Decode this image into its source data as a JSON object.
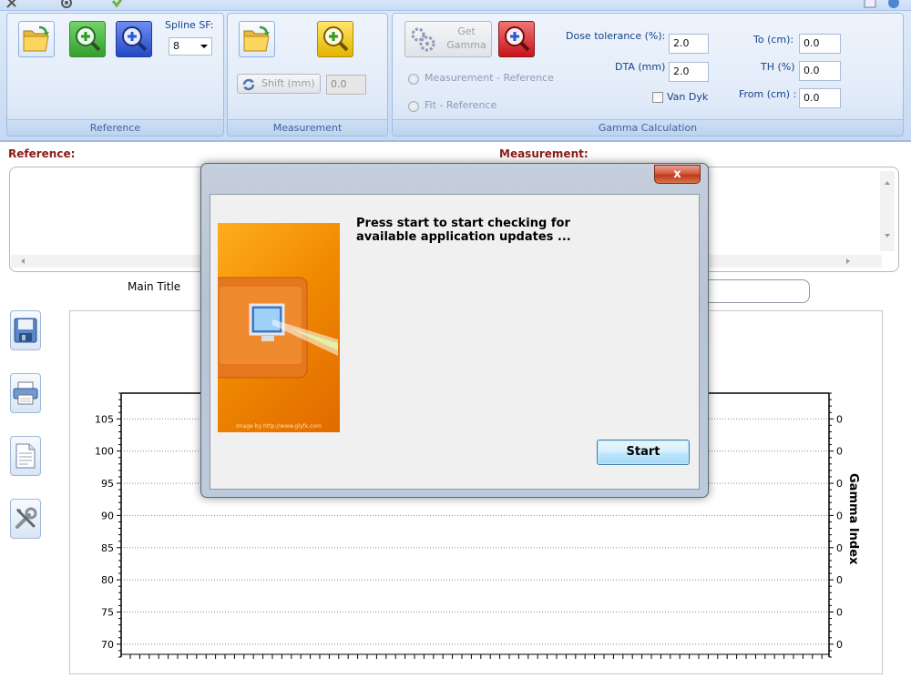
{
  "ribbon": {
    "reference": {
      "label": "Reference",
      "spline_label": "Spline SF:",
      "spline_value": "8"
    },
    "measurement": {
      "label": "Measurement",
      "shift_label": "Shift (mm)",
      "shift_value": "0.0"
    },
    "gamma": {
      "label": "Gamma Calculation",
      "get_gamma_line1": "Get",
      "get_gamma_line2": "Gamma",
      "radio_measurement_reference": "Measurement - Reference",
      "radio_fit_reference": "Fit - Reference",
      "dose_tolerance_label": "Dose tolerance (%):",
      "dose_tolerance_value": "2.0",
      "dta_label": "DTA (mm)",
      "dta_value": "2.0",
      "van_dyk_label": "Van Dyk",
      "to_label": "To (cm):",
      "to_value": "0.0",
      "th_label": "TH (%)",
      "th_value": "0.0",
      "from_label": "From (cm) :",
      "from_value": "0.0"
    }
  },
  "main": {
    "reference_title": "Reference:",
    "measurement_title": "Measurement:",
    "chart_main_title": "Main Title"
  },
  "chart_data": {
    "type": "line",
    "y_ticks": [
      105,
      100,
      95,
      90,
      85,
      80,
      75,
      70
    ],
    "ylim": [
      68,
      109
    ],
    "y2label": "Gamma Index",
    "y2_ticks": [
      "0",
      "0",
      "0",
      "0",
      "0",
      "0",
      "0",
      "0"
    ],
    "grid": true,
    "series": []
  },
  "dialog": {
    "close_label": "x",
    "message": "Press start to start checking for\navailable application updates ...",
    "image_credit": "Image by http://www.glyfx.com",
    "start_label": "Start"
  },
  "colors": {
    "ribbon_bg": "#dfeaf8",
    "section_title": "#8b1a1a",
    "dialog_orange": "#f18a00"
  }
}
